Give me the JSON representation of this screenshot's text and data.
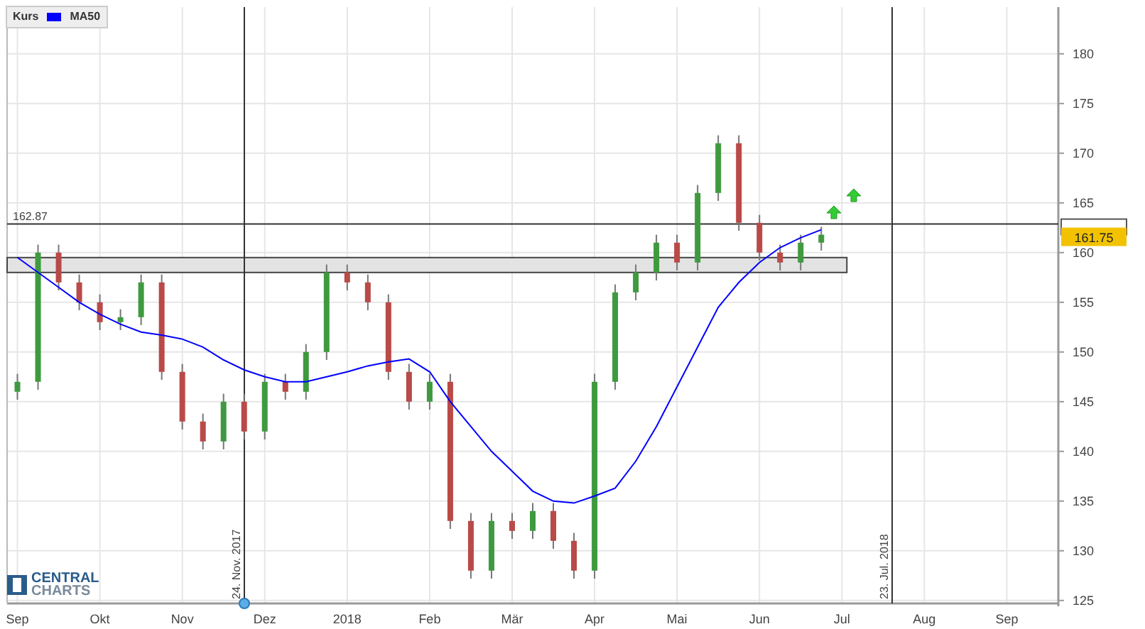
{
  "chart_data": {
    "type": "candlestick",
    "categories": [
      "Sep",
      null,
      null,
      null,
      "Okt",
      null,
      null,
      null,
      "Nov",
      null,
      null,
      null,
      "Dez",
      null,
      null,
      null,
      "2018",
      null,
      null,
      null,
      "Feb",
      null,
      null,
      null,
      "Mär",
      null,
      null,
      null,
      "Apr",
      null,
      null,
      null,
      "Mai",
      null,
      null,
      null,
      "Jun",
      null,
      null,
      null,
      "Jul",
      null,
      null,
      null,
      "Aug",
      null,
      null,
      null,
      "Sep",
      null,
      null
    ],
    "ohlc": [
      [
        146,
        147.8,
        145.2,
        147
      ],
      [
        147,
        160.8,
        146.2,
        160
      ],
      [
        160,
        160.8,
        156.2,
        157
      ],
      [
        157,
        157.8,
        154.2,
        155
      ],
      [
        155,
        155.8,
        152.2,
        153
      ],
      [
        153,
        154.3,
        152.2,
        153.5
      ],
      [
        153.5,
        157.8,
        152.7,
        157
      ],
      [
        157,
        157.8,
        147.2,
        148
      ],
      [
        148,
        148.8,
        142.2,
        143
      ],
      [
        143,
        143.8,
        140.2,
        141
      ],
      [
        141,
        145.8,
        140.2,
        145
      ],
      [
        145,
        145.8,
        141.2,
        142
      ],
      [
        142,
        147.8,
        141.2,
        147
      ],
      [
        147,
        147.8,
        145.2,
        146
      ],
      [
        146,
        150.8,
        145.2,
        150
      ],
      [
        150,
        158.8,
        149.2,
        158
      ],
      [
        158,
        158.8,
        156.2,
        157
      ],
      [
        157,
        157.8,
        154.2,
        155
      ],
      [
        155,
        155.8,
        147.2,
        148
      ],
      [
        148,
        148.8,
        144.2,
        145
      ],
      [
        145,
        147.8,
        144.2,
        147
      ],
      [
        147,
        147.8,
        132.2,
        133
      ],
      [
        133,
        133.8,
        127.2,
        128
      ],
      [
        128,
        133.8,
        127.2,
        133
      ],
      [
        133,
        133.8,
        131.2,
        132
      ],
      [
        132,
        134.8,
        131.2,
        134
      ],
      [
        134,
        134.8,
        130.2,
        131
      ],
      [
        131,
        131.8,
        127.2,
        128
      ],
      [
        128,
        147.8,
        127.2,
        147
      ],
      [
        147,
        156.8,
        146.2,
        156
      ],
      [
        156,
        158.8,
        155.2,
        158
      ],
      [
        158,
        161.8,
        157.2,
        161
      ],
      [
        161,
        161.8,
        158.2,
        159
      ],
      [
        159,
        166.8,
        158.2,
        166
      ],
      [
        166,
        171.8,
        165.2,
        171
      ],
      [
        171,
        171.8,
        162.2,
        163
      ],
      [
        163,
        163.8,
        159.2,
        160
      ],
      [
        160,
        160.8,
        158.2,
        159
      ],
      [
        159,
        161.8,
        158.2,
        161
      ],
      [
        161,
        162.6,
        160.2,
        161.8
      ],
      null,
      null,
      null,
      null,
      null,
      null,
      null,
      null,
      null,
      null,
      null
    ],
    "series": [
      {
        "name": "MA50",
        "type": "line",
        "color": "#0000ff",
        "values": [
          159.5,
          158,
          156.5,
          155,
          153.8,
          152.8,
          152,
          151.7,
          151.3,
          150.5,
          149.2,
          148.2,
          147.5,
          147,
          147,
          147.5,
          148,
          148.6,
          149,
          149.3,
          148,
          145,
          142.5,
          140,
          138,
          136,
          135,
          134.8,
          135.5,
          136.3,
          139,
          142.5,
          146.5,
          150.5,
          154.5,
          157,
          159,
          160.5,
          161.5,
          162.3,
          null,
          null,
          null,
          null,
          null,
          null,
          null,
          null,
          null,
          null,
          null
        ]
      }
    ],
    "ylim": [
      124.7,
      184.7
    ],
    "grid": true,
    "yticks": [
      125,
      130,
      135,
      140,
      145,
      150,
      155,
      160,
      165,
      170,
      175,
      180
    ],
    "ref_lines": [
      {
        "axis": "y",
        "value": 162.87,
        "label": "162.87"
      }
    ],
    "bands": [
      {
        "axis": "y",
        "from": 158,
        "to": 159.5
      }
    ],
    "annotations": [
      "161.75"
    ]
  },
  "date_lines": [
    {
      "label": "24. Nov. 2017",
      "marker": true
    },
    {
      "label": "23. Jul. 2018",
      "marker": false
    }
  ],
  "legend": [
    {
      "label": "Kurs"
    }
  ],
  "logo": {
    "line1": "CENTRAL",
    "line2": "CHARTS"
  }
}
